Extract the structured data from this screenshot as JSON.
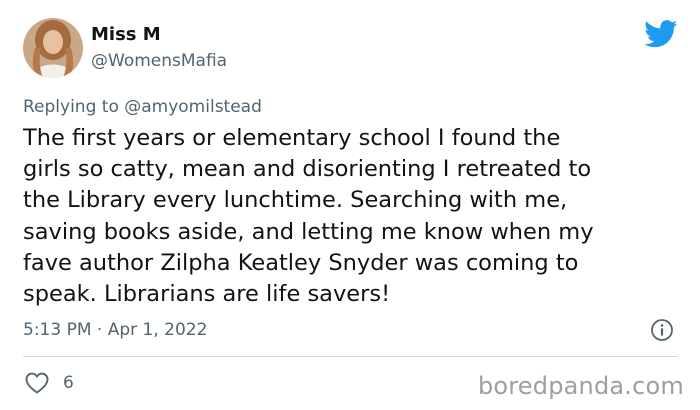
{
  "author": {
    "display_name": "Miss M",
    "handle": "@WomensMafia"
  },
  "reply": {
    "text": "Replying to @amyomilstead"
  },
  "tweet": {
    "lines": [
      "The first years or elementary school I found the",
      "girls so catty, mean and disorienting I retreated to",
      "the Library every lunchtime. Searching with me,",
      "saving books aside, and letting me know when my",
      "fave author Zilpha Keatley Snyder was coming to",
      "speak. Librarians are life savers!"
    ],
    "timestamp": "5:13 PM · Apr 1, 2022"
  },
  "actions": {
    "like_count": "6"
  },
  "watermark": "boredpanda.com",
  "icons": {
    "brand": "twitter-bird-icon",
    "info": "info-icon",
    "like": "heart-icon"
  },
  "colors": {
    "brand_blue": "#1d9bf0",
    "secondary_text": "#536471",
    "primary_text": "#0f1419",
    "divider": "#cfd9de"
  }
}
